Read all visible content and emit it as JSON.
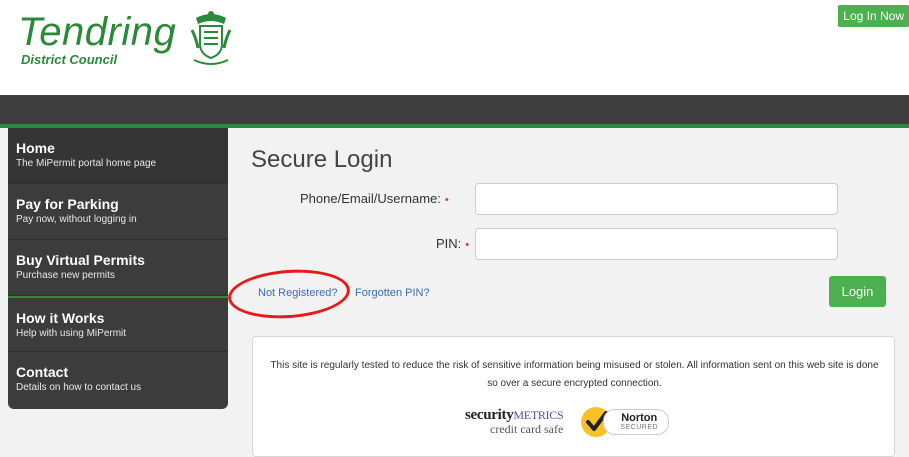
{
  "header": {
    "logo_name": "Tendring",
    "logo_sub": "District Council",
    "login_now": "Log In Now"
  },
  "sidebar": {
    "items": [
      {
        "title": "Home",
        "desc": "The MiPermit portal home page"
      },
      {
        "title": "Pay for Parking",
        "desc": "Pay now, without logging in"
      },
      {
        "title": "Buy Virtual Permits",
        "desc": "Purchase new permits"
      },
      {
        "title": "How it Works",
        "desc": "Help with using MiPermit"
      },
      {
        "title": "Contact",
        "desc": "Details on how to contact us"
      }
    ]
  },
  "login": {
    "title": "Secure Login",
    "username_label": "Phone/Email/Username:",
    "pin_label": "PIN:",
    "required_marker": "•",
    "not_registered": "Not Registered?",
    "forgotten_pin": "Forgotten PIN?",
    "login_button": "Login"
  },
  "security": {
    "text": "This site is regularly tested to reduce the risk of sensitive information being misused or stolen. All information sent on this web site is done so over a secure encrypted connection.",
    "sm_security": "security",
    "sm_metrics": "METRICS",
    "sm_sub": "credit card safe",
    "norton_name": "Norton",
    "norton_sub": "SECURED"
  },
  "colors": {
    "brand_green": "#2a8a3a",
    "button_green": "#4caf50",
    "sidebar_bg": "#3c3c3c",
    "annotation_red": "#e31b1b"
  }
}
